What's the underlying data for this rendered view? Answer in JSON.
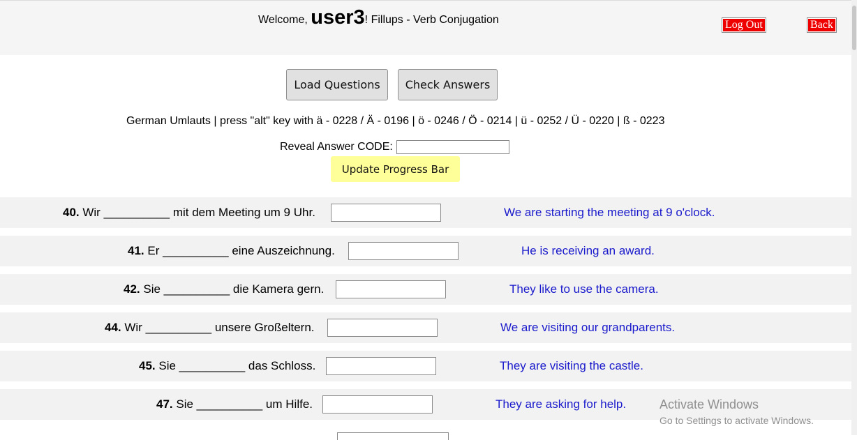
{
  "header": {
    "welcome_prefix": "Welcome, ",
    "username": "user3",
    "welcome_suffix": "! Fillups - Verb Conjugation",
    "logout_label": "Log Out",
    "back_label": "Back"
  },
  "toolbar": {
    "load_label": "Load Questions",
    "check_label": "Check Answers"
  },
  "umlaut_hint": "German Umlauts | press \"alt\" key with ä - 0228 / Ä - 0196 | ö - 0246 / Ö - 0214 | ü - 0252 / Ü - 0220 | ß - 0223",
  "reveal": {
    "label": "Reveal Answer CODE:",
    "value": ""
  },
  "progress_label": "Update Progress Bar",
  "questions": [
    {
      "num": "40.",
      "text": " Wir __________ mit dem Meeting um 9 Uhr.",
      "answer": "",
      "translation": "We are starting the meeting at 9 o'clock."
    },
    {
      "num": "41.",
      "text": " Er __________ eine Auszeichnung.",
      "answer": "",
      "translation": "He is receiving an award."
    },
    {
      "num": "42.",
      "text": " Sie __________ die Kamera gern.",
      "answer": "",
      "translation": "They like to use the camera."
    },
    {
      "num": "44.",
      "text": " Wir __________ unsere Großeltern.",
      "answer": "",
      "translation": "We are visiting our grandparents."
    },
    {
      "num": "45.",
      "text": " Sie __________ das Schloss.",
      "answer": "",
      "translation": "They are visiting the castle."
    },
    {
      "num": "47.",
      "text": " Sie __________ um Hilfe.",
      "answer": "",
      "translation": "They are asking for help."
    }
  ],
  "watermark": {
    "line1": "Activate Windows",
    "line2": "Go to Settings to activate Windows."
  },
  "colors": {
    "accent_red": "#ee0000",
    "translation_blue": "#1a1acc",
    "progress_yellow": "#ffff99"
  }
}
